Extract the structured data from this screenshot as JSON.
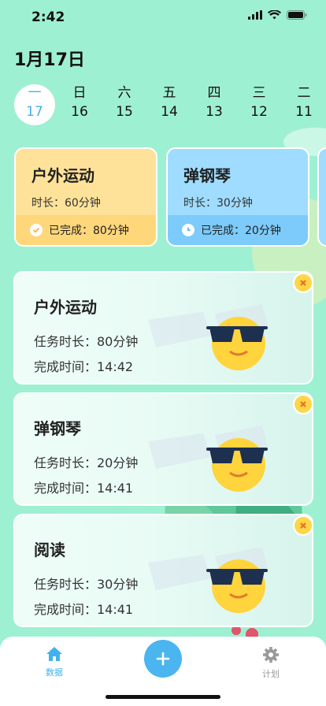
{
  "status_bar": {
    "time": "2:42"
  },
  "header": {
    "date": "1月17日"
  },
  "days": [
    {
      "week": "一",
      "day": "17",
      "selected": true
    },
    {
      "week": "日",
      "day": "16"
    },
    {
      "week": "六",
      "day": "15"
    },
    {
      "week": "五",
      "day": "14"
    },
    {
      "week": "四",
      "day": "13"
    },
    {
      "week": "三",
      "day": "12"
    },
    {
      "week": "二",
      "day": "11"
    }
  ],
  "summary_cards": [
    {
      "title": "户外运动",
      "duration": "时长：60分钟",
      "status": "已完成：80分钟",
      "status_icon": "check-circle-icon",
      "color": "#ffe299"
    },
    {
      "title": "弹钢琴",
      "duration": "时长：30分钟",
      "status": "已完成：20分钟",
      "status_icon": "clock-icon",
      "color": "#9fdcff"
    }
  ],
  "records": [
    {
      "title": "户外运动",
      "task_duration": "任务时长：80分钟",
      "finish_time": "完成时间：14:42"
    },
    {
      "title": "弹钢琴",
      "task_duration": "任务时长：20分钟",
      "finish_time": "完成时间：14:41"
    },
    {
      "title": "阅读",
      "task_duration": "任务时长：30分钟",
      "finish_time": "完成时间：14:41"
    }
  ],
  "tabbar": {
    "data_label": "数据",
    "plan_label": "计划",
    "add_icon": "plus-icon",
    "active_color": "#42b2ee",
    "inactive_color": "#9a9a9a"
  }
}
